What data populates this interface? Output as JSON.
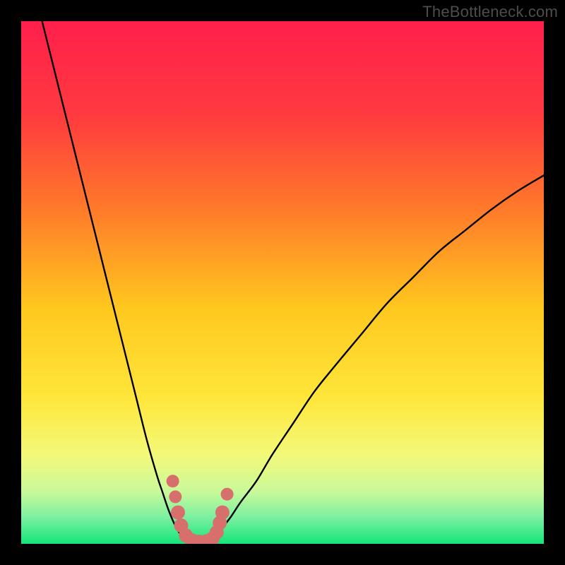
{
  "watermark": "TheBottleneck.com",
  "chart_data": {
    "type": "line",
    "title": "",
    "xlabel": "",
    "ylabel": "",
    "xlim": [
      0,
      100
    ],
    "ylim": [
      0,
      100
    ],
    "gradient_stops": [
      {
        "offset": 0.0,
        "color": "#ff1f4b"
      },
      {
        "offset": 0.18,
        "color": "#ff3a3f"
      },
      {
        "offset": 0.36,
        "color": "#ff7a2a"
      },
      {
        "offset": 0.55,
        "color": "#ffc81e"
      },
      {
        "offset": 0.72,
        "color": "#ffe63a"
      },
      {
        "offset": 0.83,
        "color": "#f3f979"
      },
      {
        "offset": 0.9,
        "color": "#c9f99a"
      },
      {
        "offset": 0.95,
        "color": "#7af0a0"
      },
      {
        "offset": 1.0,
        "color": "#15e47a"
      }
    ],
    "series": [
      {
        "name": "left-branch",
        "x": [
          4,
          6,
          8,
          10,
          12,
          14,
          16,
          18,
          20,
          22,
          24,
          26,
          27,
          28,
          29,
          30,
          31
        ],
        "y": [
          100,
          92,
          84,
          76,
          68,
          60,
          52,
          44,
          36,
          28,
          20,
          13,
          10,
          7,
          4.5,
          2.5,
          1.2
        ]
      },
      {
        "name": "right-branch",
        "x": [
          37,
          38,
          40,
          42,
          45,
          48,
          52,
          56,
          60,
          65,
          70,
          75,
          80,
          85,
          90,
          95,
          100
        ],
        "y": [
          1.2,
          2.5,
          5,
          8,
          12,
          17,
          23,
          29,
          34,
          40,
          46,
          51,
          56,
          60,
          64,
          67.5,
          70.5
        ]
      }
    ],
    "valley_floor": {
      "x": [
        31,
        37
      ],
      "y": [
        0.4,
        0.4
      ]
    },
    "marker_points": {
      "name": "accent-dots",
      "color": "#d76f6c",
      "points": [
        {
          "x": 29.0,
          "y": 12.0,
          "r": 9
        },
        {
          "x": 29.5,
          "y": 9.0,
          "r": 9
        },
        {
          "x": 30.0,
          "y": 6.0,
          "r": 10
        },
        {
          "x": 30.6,
          "y": 3.5,
          "r": 10
        },
        {
          "x": 31.5,
          "y": 1.6,
          "r": 10
        },
        {
          "x": 32.6,
          "y": 0.7,
          "r": 10
        },
        {
          "x": 34.0,
          "y": 0.4,
          "r": 10
        },
        {
          "x": 35.4,
          "y": 0.5,
          "r": 10
        },
        {
          "x": 36.6,
          "y": 1.0,
          "r": 10
        },
        {
          "x": 37.4,
          "y": 2.2,
          "r": 10
        },
        {
          "x": 38.0,
          "y": 4.0,
          "r": 10
        },
        {
          "x": 38.5,
          "y": 6.0,
          "r": 10
        },
        {
          "x": 39.4,
          "y": 9.5,
          "r": 9
        }
      ]
    }
  }
}
